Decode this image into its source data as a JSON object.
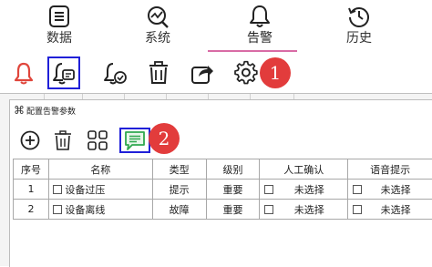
{
  "nav": {
    "tabs": [
      {
        "label": "数据",
        "icon": "data-list-icon"
      },
      {
        "label": "系统",
        "icon": "system-monitor-icon"
      },
      {
        "label": "告警",
        "icon": "bell-icon",
        "active": true
      },
      {
        "label": "历史",
        "icon": "history-clock-icon"
      }
    ],
    "active_color": "#d96ca5"
  },
  "toolbar": {
    "buttons": [
      {
        "icon": "bell-red-icon"
      },
      {
        "icon": "bell-message-icon",
        "selected": true
      },
      {
        "icon": "bell-check-icon"
      },
      {
        "icon": "trash-icon"
      },
      {
        "icon": "share-icon"
      },
      {
        "icon": "gear-icon"
      }
    ],
    "badge": "1"
  },
  "dialog": {
    "title": "配置告警参数",
    "toolbar_badge": "2",
    "toolbar": [
      {
        "icon": "add-circle-icon"
      },
      {
        "icon": "trash-icon"
      },
      {
        "icon": "grid-icon"
      },
      {
        "icon": "chat-message-icon",
        "selected": true
      }
    ]
  },
  "table": {
    "headers": [
      "序号",
      "名称",
      "类型",
      "级别",
      "人工确认",
      "语音提示"
    ],
    "rows": [
      {
        "index": "1",
        "name": "设备过压",
        "type": "提示",
        "level": "重要",
        "confirm": "未选择",
        "voice": "未选择"
      },
      {
        "index": "2",
        "name": "设备离线",
        "type": "故障",
        "level": "重要",
        "confirm": "未选择",
        "voice": "未选择"
      }
    ]
  },
  "colors": {
    "badge": "#e23c3c",
    "selection": "#2020d8",
    "chat_icon": "#2fa84f",
    "bell_red": "#e0463c"
  }
}
